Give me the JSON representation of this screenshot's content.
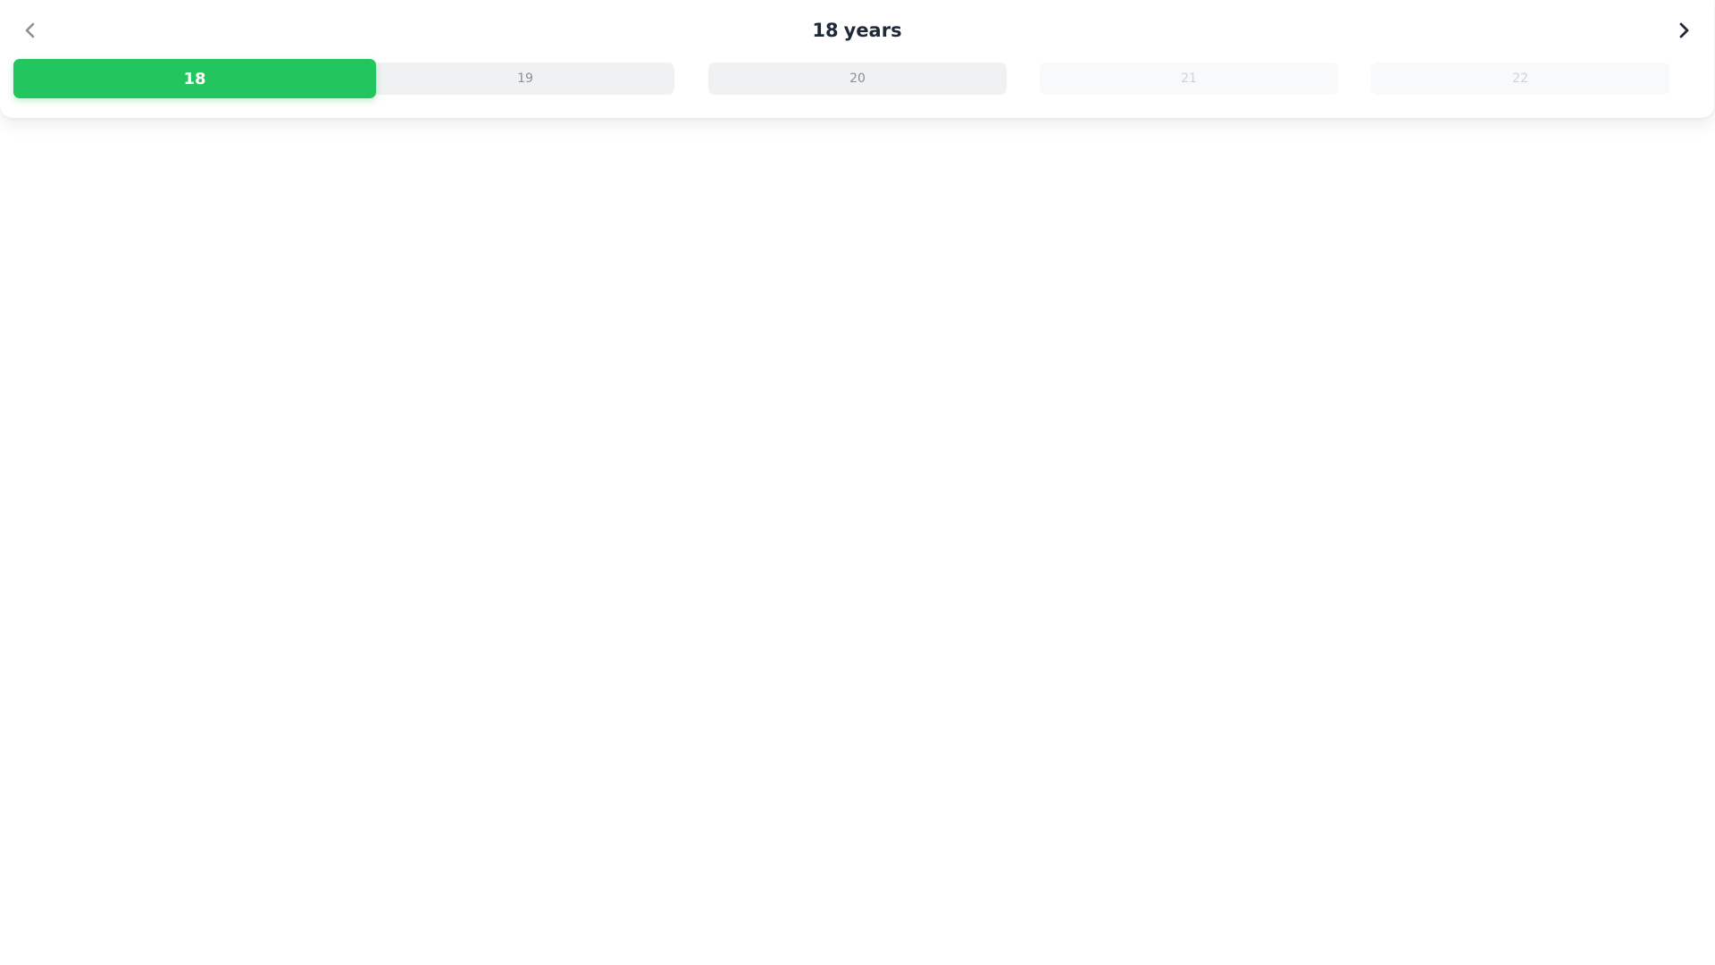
{
  "header": {
    "selected_value": "18",
    "unit_label": "years",
    "prev_icon": "chevron-left-icon",
    "next_icon": "chevron-right-icon"
  },
  "options": [
    {
      "label": "18",
      "selected": true,
      "state": "selected"
    },
    {
      "label": "19",
      "selected": false,
      "state": "near"
    },
    {
      "label": "20",
      "selected": false,
      "state": "near"
    },
    {
      "label": "21",
      "selected": false,
      "state": "far"
    },
    {
      "label": "22",
      "selected": false,
      "state": "far"
    }
  ],
  "colors": {
    "accent": "#22c55e",
    "accent_text": "#ffffff",
    "title_text": "#1f2937",
    "near_bg": "#f0f1f3",
    "near_text": "#8a9099",
    "far_bg": "#f8f9fa",
    "far_text": "#cfd3d8",
    "prev_icon": "#8b8f96",
    "next_icon": "#1f2937"
  }
}
